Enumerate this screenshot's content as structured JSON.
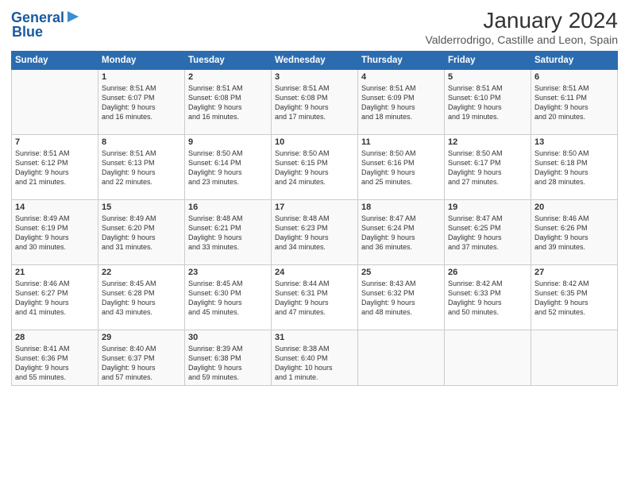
{
  "logo": {
    "text1": "General",
    "text2": "Blue"
  },
  "title": "January 2024",
  "location": "Valderrodrigo, Castille and Leon, Spain",
  "days_header": [
    "Sunday",
    "Monday",
    "Tuesday",
    "Wednesday",
    "Thursday",
    "Friday",
    "Saturday"
  ],
  "weeks": [
    [
      {
        "day": "",
        "text": ""
      },
      {
        "day": "1",
        "text": "Sunrise: 8:51 AM\nSunset: 6:07 PM\nDaylight: 9 hours\nand 16 minutes."
      },
      {
        "day": "2",
        "text": "Sunrise: 8:51 AM\nSunset: 6:08 PM\nDaylight: 9 hours\nand 16 minutes."
      },
      {
        "day": "3",
        "text": "Sunrise: 8:51 AM\nSunset: 6:08 PM\nDaylight: 9 hours\nand 17 minutes."
      },
      {
        "day": "4",
        "text": "Sunrise: 8:51 AM\nSunset: 6:09 PM\nDaylight: 9 hours\nand 18 minutes."
      },
      {
        "day": "5",
        "text": "Sunrise: 8:51 AM\nSunset: 6:10 PM\nDaylight: 9 hours\nand 19 minutes."
      },
      {
        "day": "6",
        "text": "Sunrise: 8:51 AM\nSunset: 6:11 PM\nDaylight: 9 hours\nand 20 minutes."
      }
    ],
    [
      {
        "day": "7",
        "text": "Sunrise: 8:51 AM\nSunset: 6:12 PM\nDaylight: 9 hours\nand 21 minutes."
      },
      {
        "day": "8",
        "text": "Sunrise: 8:51 AM\nSunset: 6:13 PM\nDaylight: 9 hours\nand 22 minutes."
      },
      {
        "day": "9",
        "text": "Sunrise: 8:50 AM\nSunset: 6:14 PM\nDaylight: 9 hours\nand 23 minutes."
      },
      {
        "day": "10",
        "text": "Sunrise: 8:50 AM\nSunset: 6:15 PM\nDaylight: 9 hours\nand 24 minutes."
      },
      {
        "day": "11",
        "text": "Sunrise: 8:50 AM\nSunset: 6:16 PM\nDaylight: 9 hours\nand 25 minutes."
      },
      {
        "day": "12",
        "text": "Sunrise: 8:50 AM\nSunset: 6:17 PM\nDaylight: 9 hours\nand 27 minutes."
      },
      {
        "day": "13",
        "text": "Sunrise: 8:50 AM\nSunset: 6:18 PM\nDaylight: 9 hours\nand 28 minutes."
      }
    ],
    [
      {
        "day": "14",
        "text": "Sunrise: 8:49 AM\nSunset: 6:19 PM\nDaylight: 9 hours\nand 30 minutes."
      },
      {
        "day": "15",
        "text": "Sunrise: 8:49 AM\nSunset: 6:20 PM\nDaylight: 9 hours\nand 31 minutes."
      },
      {
        "day": "16",
        "text": "Sunrise: 8:48 AM\nSunset: 6:21 PM\nDaylight: 9 hours\nand 33 minutes."
      },
      {
        "day": "17",
        "text": "Sunrise: 8:48 AM\nSunset: 6:23 PM\nDaylight: 9 hours\nand 34 minutes."
      },
      {
        "day": "18",
        "text": "Sunrise: 8:47 AM\nSunset: 6:24 PM\nDaylight: 9 hours\nand 36 minutes."
      },
      {
        "day": "19",
        "text": "Sunrise: 8:47 AM\nSunset: 6:25 PM\nDaylight: 9 hours\nand 37 minutes."
      },
      {
        "day": "20",
        "text": "Sunrise: 8:46 AM\nSunset: 6:26 PM\nDaylight: 9 hours\nand 39 minutes."
      }
    ],
    [
      {
        "day": "21",
        "text": "Sunrise: 8:46 AM\nSunset: 6:27 PM\nDaylight: 9 hours\nand 41 minutes."
      },
      {
        "day": "22",
        "text": "Sunrise: 8:45 AM\nSunset: 6:28 PM\nDaylight: 9 hours\nand 43 minutes."
      },
      {
        "day": "23",
        "text": "Sunrise: 8:45 AM\nSunset: 6:30 PM\nDaylight: 9 hours\nand 45 minutes."
      },
      {
        "day": "24",
        "text": "Sunrise: 8:44 AM\nSunset: 6:31 PM\nDaylight: 9 hours\nand 47 minutes."
      },
      {
        "day": "25",
        "text": "Sunrise: 8:43 AM\nSunset: 6:32 PM\nDaylight: 9 hours\nand 48 minutes."
      },
      {
        "day": "26",
        "text": "Sunrise: 8:42 AM\nSunset: 6:33 PM\nDaylight: 9 hours\nand 50 minutes."
      },
      {
        "day": "27",
        "text": "Sunrise: 8:42 AM\nSunset: 6:35 PM\nDaylight: 9 hours\nand 52 minutes."
      }
    ],
    [
      {
        "day": "28",
        "text": "Sunrise: 8:41 AM\nSunset: 6:36 PM\nDaylight: 9 hours\nand 55 minutes."
      },
      {
        "day": "29",
        "text": "Sunrise: 8:40 AM\nSunset: 6:37 PM\nDaylight: 9 hours\nand 57 minutes."
      },
      {
        "day": "30",
        "text": "Sunrise: 8:39 AM\nSunset: 6:38 PM\nDaylight: 9 hours\nand 59 minutes."
      },
      {
        "day": "31",
        "text": "Sunrise: 8:38 AM\nSunset: 6:40 PM\nDaylight: 10 hours\nand 1 minute."
      },
      {
        "day": "",
        "text": ""
      },
      {
        "day": "",
        "text": ""
      },
      {
        "day": "",
        "text": ""
      }
    ]
  ]
}
